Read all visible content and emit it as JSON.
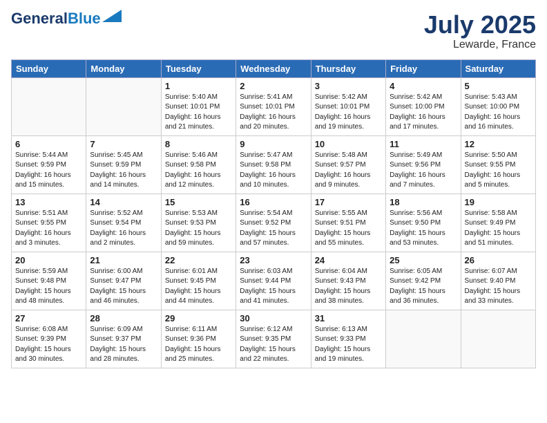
{
  "logo": {
    "line1": "General",
    "line2": "Blue"
  },
  "title": "July 2025",
  "location": "Lewarde, France",
  "days_header": [
    "Sunday",
    "Monday",
    "Tuesday",
    "Wednesday",
    "Thursday",
    "Friday",
    "Saturday"
  ],
  "weeks": [
    [
      {
        "day": "",
        "info": ""
      },
      {
        "day": "",
        "info": ""
      },
      {
        "day": "1",
        "info": "Sunrise: 5:40 AM\nSunset: 10:01 PM\nDaylight: 16 hours\nand 21 minutes."
      },
      {
        "day": "2",
        "info": "Sunrise: 5:41 AM\nSunset: 10:01 PM\nDaylight: 16 hours\nand 20 minutes."
      },
      {
        "day": "3",
        "info": "Sunrise: 5:42 AM\nSunset: 10:01 PM\nDaylight: 16 hours\nand 19 minutes."
      },
      {
        "day": "4",
        "info": "Sunrise: 5:42 AM\nSunset: 10:00 PM\nDaylight: 16 hours\nand 17 minutes."
      },
      {
        "day": "5",
        "info": "Sunrise: 5:43 AM\nSunset: 10:00 PM\nDaylight: 16 hours\nand 16 minutes."
      }
    ],
    [
      {
        "day": "6",
        "info": "Sunrise: 5:44 AM\nSunset: 9:59 PM\nDaylight: 16 hours\nand 15 minutes."
      },
      {
        "day": "7",
        "info": "Sunrise: 5:45 AM\nSunset: 9:59 PM\nDaylight: 16 hours\nand 14 minutes."
      },
      {
        "day": "8",
        "info": "Sunrise: 5:46 AM\nSunset: 9:58 PM\nDaylight: 16 hours\nand 12 minutes."
      },
      {
        "day": "9",
        "info": "Sunrise: 5:47 AM\nSunset: 9:58 PM\nDaylight: 16 hours\nand 10 minutes."
      },
      {
        "day": "10",
        "info": "Sunrise: 5:48 AM\nSunset: 9:57 PM\nDaylight: 16 hours\nand 9 minutes."
      },
      {
        "day": "11",
        "info": "Sunrise: 5:49 AM\nSunset: 9:56 PM\nDaylight: 16 hours\nand 7 minutes."
      },
      {
        "day": "12",
        "info": "Sunrise: 5:50 AM\nSunset: 9:55 PM\nDaylight: 16 hours\nand 5 minutes."
      }
    ],
    [
      {
        "day": "13",
        "info": "Sunrise: 5:51 AM\nSunset: 9:55 PM\nDaylight: 16 hours\nand 3 minutes."
      },
      {
        "day": "14",
        "info": "Sunrise: 5:52 AM\nSunset: 9:54 PM\nDaylight: 16 hours\nand 2 minutes."
      },
      {
        "day": "15",
        "info": "Sunrise: 5:53 AM\nSunset: 9:53 PM\nDaylight: 15 hours\nand 59 minutes."
      },
      {
        "day": "16",
        "info": "Sunrise: 5:54 AM\nSunset: 9:52 PM\nDaylight: 15 hours\nand 57 minutes."
      },
      {
        "day": "17",
        "info": "Sunrise: 5:55 AM\nSunset: 9:51 PM\nDaylight: 15 hours\nand 55 minutes."
      },
      {
        "day": "18",
        "info": "Sunrise: 5:56 AM\nSunset: 9:50 PM\nDaylight: 15 hours\nand 53 minutes."
      },
      {
        "day": "19",
        "info": "Sunrise: 5:58 AM\nSunset: 9:49 PM\nDaylight: 15 hours\nand 51 minutes."
      }
    ],
    [
      {
        "day": "20",
        "info": "Sunrise: 5:59 AM\nSunset: 9:48 PM\nDaylight: 15 hours\nand 48 minutes."
      },
      {
        "day": "21",
        "info": "Sunrise: 6:00 AM\nSunset: 9:47 PM\nDaylight: 15 hours\nand 46 minutes."
      },
      {
        "day": "22",
        "info": "Sunrise: 6:01 AM\nSunset: 9:45 PM\nDaylight: 15 hours\nand 44 minutes."
      },
      {
        "day": "23",
        "info": "Sunrise: 6:03 AM\nSunset: 9:44 PM\nDaylight: 15 hours\nand 41 minutes."
      },
      {
        "day": "24",
        "info": "Sunrise: 6:04 AM\nSunset: 9:43 PM\nDaylight: 15 hours\nand 38 minutes."
      },
      {
        "day": "25",
        "info": "Sunrise: 6:05 AM\nSunset: 9:42 PM\nDaylight: 15 hours\nand 36 minutes."
      },
      {
        "day": "26",
        "info": "Sunrise: 6:07 AM\nSunset: 9:40 PM\nDaylight: 15 hours\nand 33 minutes."
      }
    ],
    [
      {
        "day": "27",
        "info": "Sunrise: 6:08 AM\nSunset: 9:39 PM\nDaylight: 15 hours\nand 30 minutes."
      },
      {
        "day": "28",
        "info": "Sunrise: 6:09 AM\nSunset: 9:37 PM\nDaylight: 15 hours\nand 28 minutes."
      },
      {
        "day": "29",
        "info": "Sunrise: 6:11 AM\nSunset: 9:36 PM\nDaylight: 15 hours\nand 25 minutes."
      },
      {
        "day": "30",
        "info": "Sunrise: 6:12 AM\nSunset: 9:35 PM\nDaylight: 15 hours\nand 22 minutes."
      },
      {
        "day": "31",
        "info": "Sunrise: 6:13 AM\nSunset: 9:33 PM\nDaylight: 15 hours\nand 19 minutes."
      },
      {
        "day": "",
        "info": ""
      },
      {
        "day": "",
        "info": ""
      }
    ]
  ]
}
